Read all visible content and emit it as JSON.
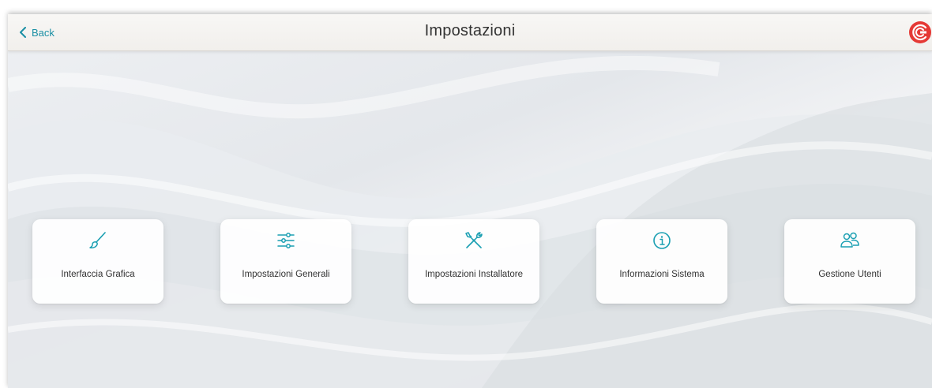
{
  "header": {
    "back_label": "Back",
    "title": "Impostazioni",
    "logo_icon": "brand-logo-icon"
  },
  "menu": {
    "items": [
      {
        "label": "Interfaccia Grafica",
        "icon": "paintbrush-icon"
      },
      {
        "label": "Impostazioni Generali",
        "icon": "sliders-icon"
      },
      {
        "label": "Impostazioni Installatore",
        "icon": "tools-icon"
      },
      {
        "label": "Informazioni Sistema",
        "icon": "info-icon"
      },
      {
        "label": "Gestione Utenti",
        "icon": "users-icon"
      }
    ]
  },
  "colors": {
    "accent": "#1a9fb2",
    "logo_red": "#e53935",
    "text": "#333333"
  }
}
